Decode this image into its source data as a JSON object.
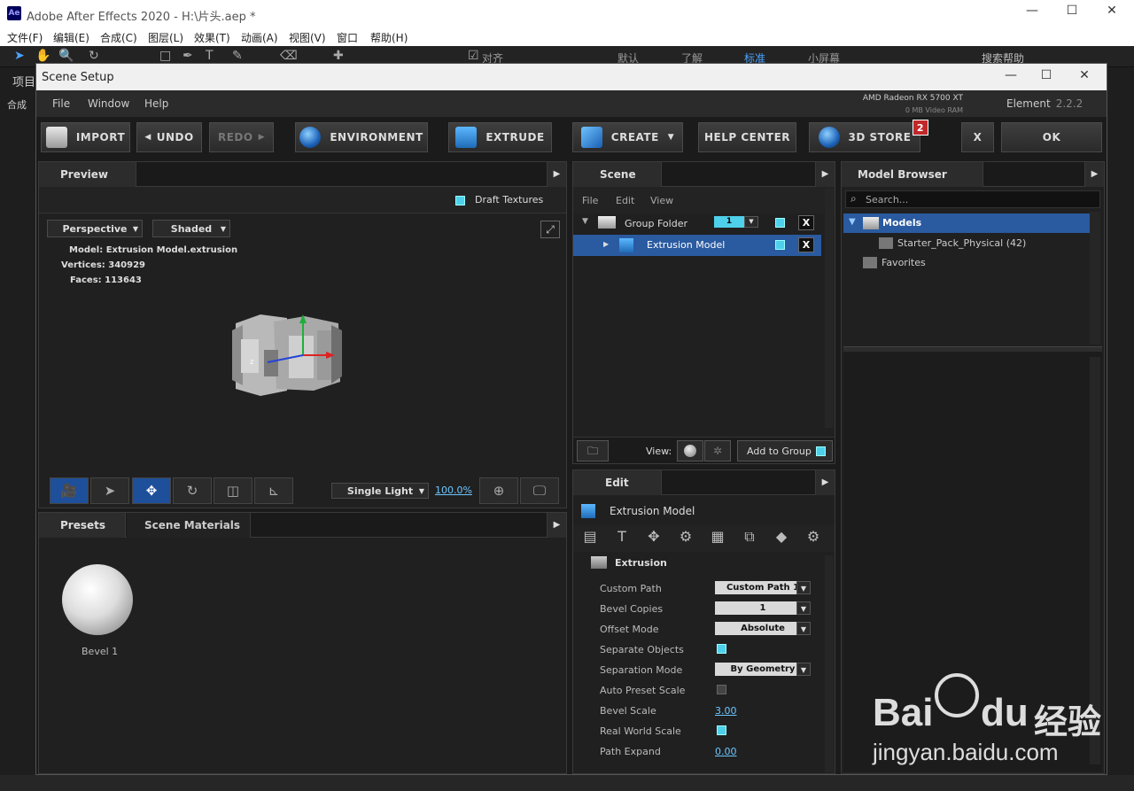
{
  "host": {
    "app_badge": "Ae",
    "title": "Adobe After Effects 2020 - H:\\片头.aep *",
    "menus": [
      "文件(F)",
      "编辑(E)",
      "合成(C)",
      "图层(L)",
      "效果(T)",
      "动画(A)",
      "视图(V)",
      "窗口",
      "帮助(H)"
    ],
    "snap_label": "对齐",
    "workspaces": [
      "默认",
      "了解",
      "标准",
      "小屏幕"
    ],
    "search_help": "搜索帮助",
    "left_labels": [
      "项目",
      "合成"
    ]
  },
  "dialog": {
    "title": "Scene Setup",
    "menus": [
      "File",
      "Window",
      "Help"
    ],
    "gpu_name": "AMD Radeon RX 5700 XT",
    "gpu_vram": "0 MB Video RAM",
    "product": "Element",
    "version": "2.2.2",
    "toolbar": {
      "import": "IMPORT",
      "undo": "UNDO",
      "redo": "REDO",
      "environment": "ENVIRONMENT",
      "extrude": "EXTRUDE",
      "create": "CREATE",
      "help_center": "HELP CENTER",
      "store": "3D STORE",
      "store_badge": "2",
      "close": "X",
      "ok": "OK"
    },
    "preview": {
      "tab": "Preview",
      "draft_textures": "Draft Textures",
      "camera_mode": "Perspective",
      "shading": "Shaded",
      "model_label": "Model:",
      "model_value": "Extrusion Model.extrusion",
      "vertices_label": "Vertices:",
      "vertices_value": "340929",
      "faces_label": "Faces:",
      "faces_value": "113643",
      "light_mode": "Single Light",
      "zoom": "100.0%"
    },
    "presets": {
      "tabs": [
        "Presets",
        "Scene Materials"
      ],
      "items": [
        {
          "label": "Bevel 1"
        }
      ]
    },
    "scene": {
      "tab": "Scene",
      "menus": [
        "File",
        "Edit",
        "View"
      ],
      "group_folder": "Group Folder",
      "group_number": "1",
      "model": "Extrusion Model",
      "close_x": "X",
      "view_label": "View:",
      "add_to_group": "Add to Group"
    },
    "edit": {
      "tab": "Edit",
      "title": "Extrusion Model",
      "section": "Extrusion",
      "props": [
        {
          "label": "Custom Path",
          "kind": "select",
          "value": "Custom Path 1"
        },
        {
          "label": "Bevel Copies",
          "kind": "select",
          "value": "1"
        },
        {
          "label": "Offset Mode",
          "kind": "select",
          "value": "Absolute"
        },
        {
          "label": "Separate Objects",
          "kind": "check",
          "value": true
        },
        {
          "label": "Separation Mode",
          "kind": "select",
          "value": "By Geometry"
        },
        {
          "label": "Auto Preset Scale",
          "kind": "check",
          "value": false
        },
        {
          "label": "Bevel Scale",
          "kind": "num",
          "value": "3.00"
        },
        {
          "label": "Real World Scale",
          "kind": "check",
          "value": true
        },
        {
          "label": "Path Expand",
          "kind": "num",
          "value": "0.00"
        }
      ]
    },
    "model_browser": {
      "tab": "Model Browser",
      "search_placeholder": "Search...",
      "root": "Models",
      "pack": "Starter_Pack_Physical (42)",
      "favorites": "Favorites"
    }
  },
  "watermark": {
    "brand": "Bai",
    "brand2": "du",
    "cn": "经验",
    "url": "jingyan.baidu.com"
  },
  "colors": {
    "accent": "#4fd0ea",
    "selection": "#2a5aa0",
    "badge": "#c0282a"
  }
}
